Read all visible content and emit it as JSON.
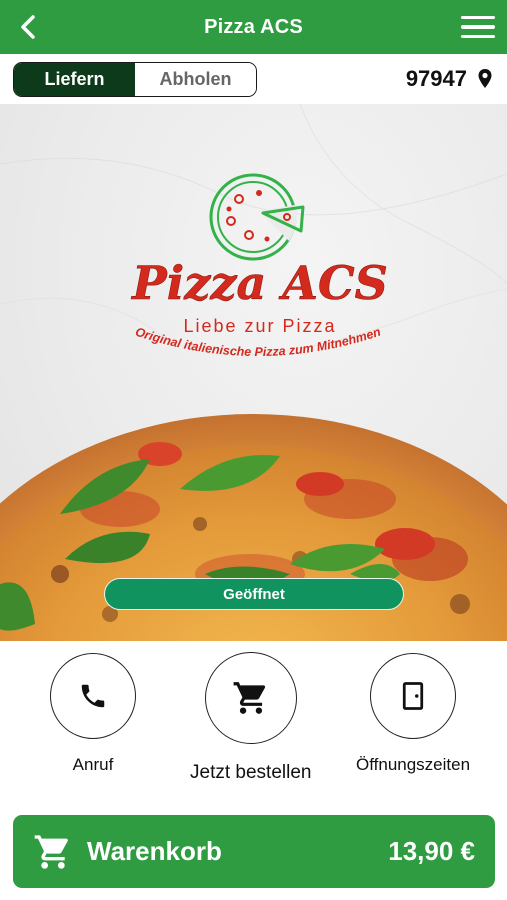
{
  "header": {
    "title": "Pizza ACS"
  },
  "delivery_toggle": {
    "options": [
      "Liefern",
      "Abholen"
    ],
    "selected": "Liefern"
  },
  "location": {
    "zip_code": "97947"
  },
  "hero": {
    "logo_name": "Pizza ACS",
    "logo_tagline": "Liebe zur Pizza",
    "logo_subline": "Original italienische Pizza zum Mitnehmen",
    "status": "Geöffnet",
    "status_color": "#10935e"
  },
  "actions": [
    {
      "label": "Anruf",
      "icon": "phone-icon"
    },
    {
      "label": "Jetzt bestellen",
      "icon": "cart-icon"
    },
    {
      "label": "Öffnungszeiten",
      "icon": "door-icon"
    }
  ],
  "cart": {
    "label": "Warenkorb",
    "total": "13,90 €"
  },
  "colors": {
    "brand_green": "#2f9c41",
    "toggle_active": "#0d3a1a",
    "logo_red": "#d42a1e"
  }
}
